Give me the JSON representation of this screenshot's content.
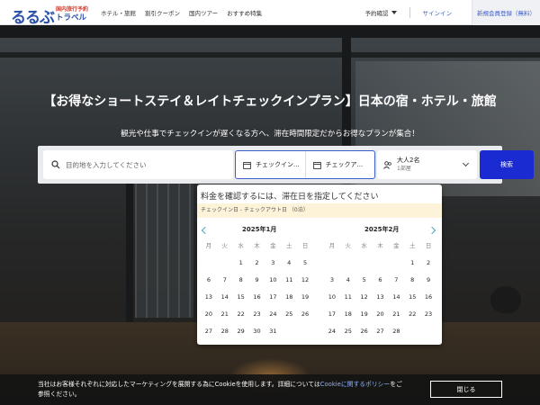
{
  "header": {
    "logo_main": "るるぶ",
    "logo_sub1": "国内旅行予約",
    "logo_sub2": "トラベル",
    "nav": [
      "ホテル・旅館",
      "割引クーポン",
      "国内ツアー",
      "おすすめ特集"
    ],
    "reservation": "予約確認",
    "signin": "サインイン",
    "register": "新規会員登録（無料）"
  },
  "hero": {
    "title": "【お得なショートステイ＆レイトチェックインプラン】日本の宿・ホテル・旅館",
    "subtitle": "観光や仕事でチェックインが遅くなる方へ、滞在時間限定だからお得なプランが集合！"
  },
  "search": {
    "destination_placeholder": "目的地を入力してください",
    "checkin": "チェックイン...",
    "checkout": "チェックア...",
    "guests": "大人2名",
    "rooms": "1部屋",
    "button": "検索"
  },
  "calendar": {
    "message": "料金を確認するには、滞在日を指定してください",
    "selection": "チェックイン日 - チェックアウト日 （0泊）",
    "weekdays": [
      "月",
      "火",
      "水",
      "木",
      "金",
      "土",
      "日"
    ],
    "months": [
      {
        "title": "2025年1月",
        "days": [
          "",
          "",
          "1",
          "2",
          "3",
          "4",
          "5",
          "6",
          "7",
          "8",
          "9",
          "10",
          "11",
          "12",
          "13",
          "14",
          "15",
          "16",
          "17",
          "18",
          "19",
          "20",
          "21",
          "22",
          "23",
          "24",
          "25",
          "26",
          "27",
          "28",
          "29",
          "30",
          "31",
          "",
          ""
        ]
      },
      {
        "title": "2025年2月",
        "days": [
          "",
          "",
          "",
          "",
          "",
          "1",
          "2",
          "3",
          "4",
          "5",
          "6",
          "7",
          "8",
          "9",
          "10",
          "11",
          "12",
          "13",
          "14",
          "15",
          "16",
          "17",
          "18",
          "19",
          "20",
          "21",
          "22",
          "23",
          "24",
          "25",
          "26",
          "27",
          "28",
          "",
          ""
        ]
      }
    ]
  },
  "cookie": {
    "text_before": "当社はお客様それぞれに対応したマーケティングを展開する為にCookieを使用します。詳細については",
    "link": "Cookieに関するポリシー",
    "text_after": "をご参照ください。",
    "button": "閉じる"
  },
  "colors": {
    "brand": "#2b50a8",
    "search_button": "#1a2bd1",
    "link": "#3a5fc8"
  }
}
